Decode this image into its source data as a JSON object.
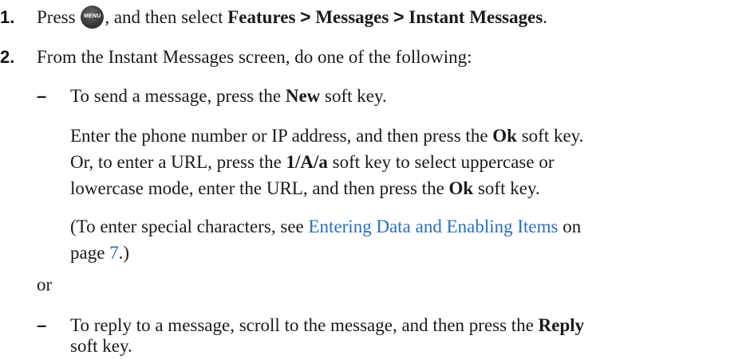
{
  "step1": {
    "number": "1.",
    "before": "Press",
    "menu_key_label": "MENU",
    "middle": ", and then select",
    "path": [
      "Features",
      "Messages",
      "Instant Messages"
    ],
    "separator": ">",
    "end": "."
  },
  "step2": {
    "number": "2.",
    "text": "From the Instant Messages screen, do one of the following:"
  },
  "option1": {
    "dash": "–",
    "line1_pre": "To send a message, press the",
    "line1_bold": "New",
    "line1_post": "soft key.",
    "para1_line1_pre": "Enter the phone number or IP address, and then press the",
    "para1_line1_bold": "Ok",
    "para1_line1_post": "soft key.",
    "para1_line2_pre": "Or, to enter a URL, press the",
    "para1_line2_bold": "1/A/a",
    "para1_line2_post": "soft key to select uppercase or",
    "para1_line3_pre": "lowercase mode, enter the URL, and then press the",
    "para1_line3_bold": "Ok",
    "para1_line3_post": "soft key.",
    "para2_line1_pre": "(To enter special characters, see",
    "para2_link": "Entering Data and Enabling Items",
    "para2_line1_post": "on",
    "para2_line2_pre": "page",
    "para2_page": "7",
    "para2_line2_post": ".)"
  },
  "or_text": "or",
  "option2": {
    "dash": "–",
    "line1_pre": "To reply to a message, scroll to the message, and then press the",
    "line1_bold": "Reply",
    "line2": "soft key."
  }
}
